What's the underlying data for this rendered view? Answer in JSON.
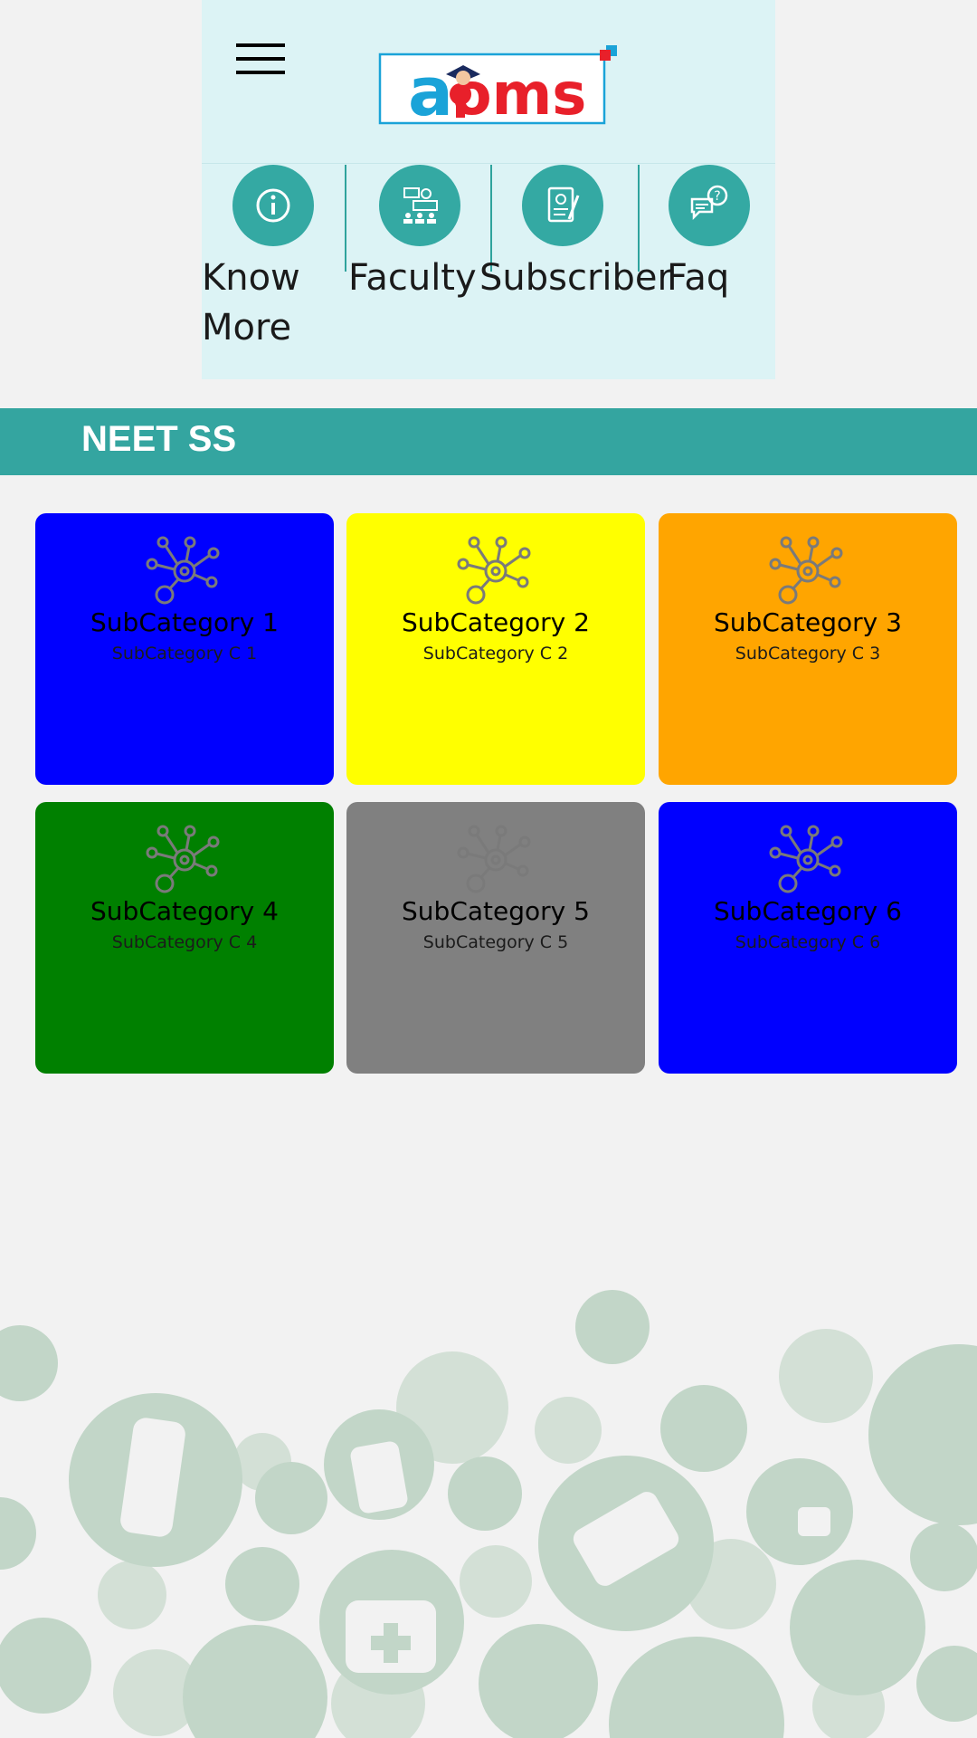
{
  "header": {
    "logo_text": "atoms",
    "nav": [
      {
        "label": "Know More",
        "icon": "info-icon"
      },
      {
        "label": "Faculty",
        "icon": "faculty-icon"
      },
      {
        "label": "Subscriber",
        "icon": "subscriber-icon"
      },
      {
        "label": "Faq",
        "icon": "faq-icon"
      }
    ]
  },
  "section": {
    "title": "NEET SS"
  },
  "subcategories": [
    {
      "title": "SubCategory 1",
      "subtitle": "SubCategory C 1",
      "color": "#0000ff"
    },
    {
      "title": "SubCategory 2",
      "subtitle": "SubCategory C 2",
      "color": "#ffff00"
    },
    {
      "title": "SubCategory 3",
      "subtitle": "SubCategory C 3",
      "color": "#ffa500"
    },
    {
      "title": "SubCategory 4",
      "subtitle": "SubCategory C 4",
      "color": "#008000"
    },
    {
      "title": "SubCategory 5",
      "subtitle": "SubCategory C 5",
      "color": "#808080"
    },
    {
      "title": "SubCategory 6",
      "subtitle": "SubCategory C 6",
      "color": "#0000ff"
    }
  ],
  "colors": {
    "header_bg": "#dcf3f5",
    "accent": "#34a5a0",
    "page_bg": "#f2f2f2",
    "medical_art": "#c2d6c8"
  }
}
